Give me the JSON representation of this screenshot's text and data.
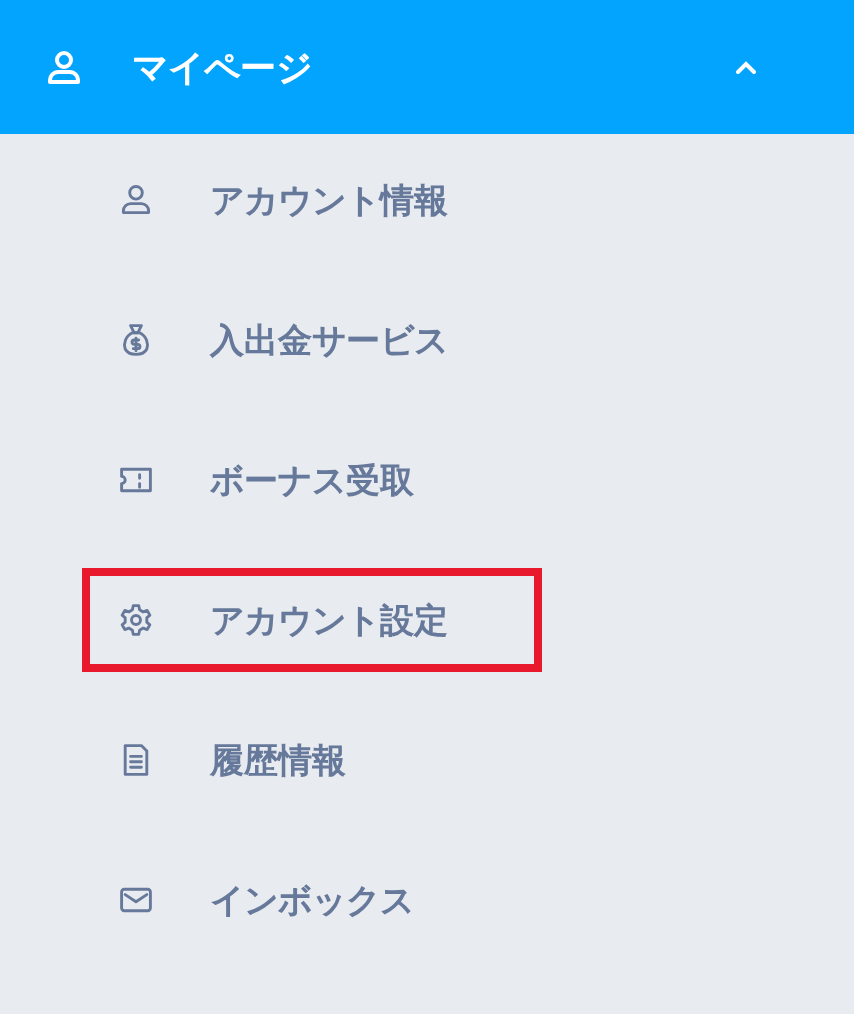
{
  "header": {
    "label": "マイページ",
    "expanded": true
  },
  "items": [
    {
      "label": "アカウント情報",
      "highlighted": false
    },
    {
      "label": "入出金サービス",
      "highlighted": false
    },
    {
      "label": "ボーナス受取",
      "highlighted": false
    },
    {
      "label": "アカウント設定",
      "highlighted": true
    },
    {
      "label": "履歴情報",
      "highlighted": false
    },
    {
      "label": "インボックス",
      "highlighted": false
    }
  ]
}
